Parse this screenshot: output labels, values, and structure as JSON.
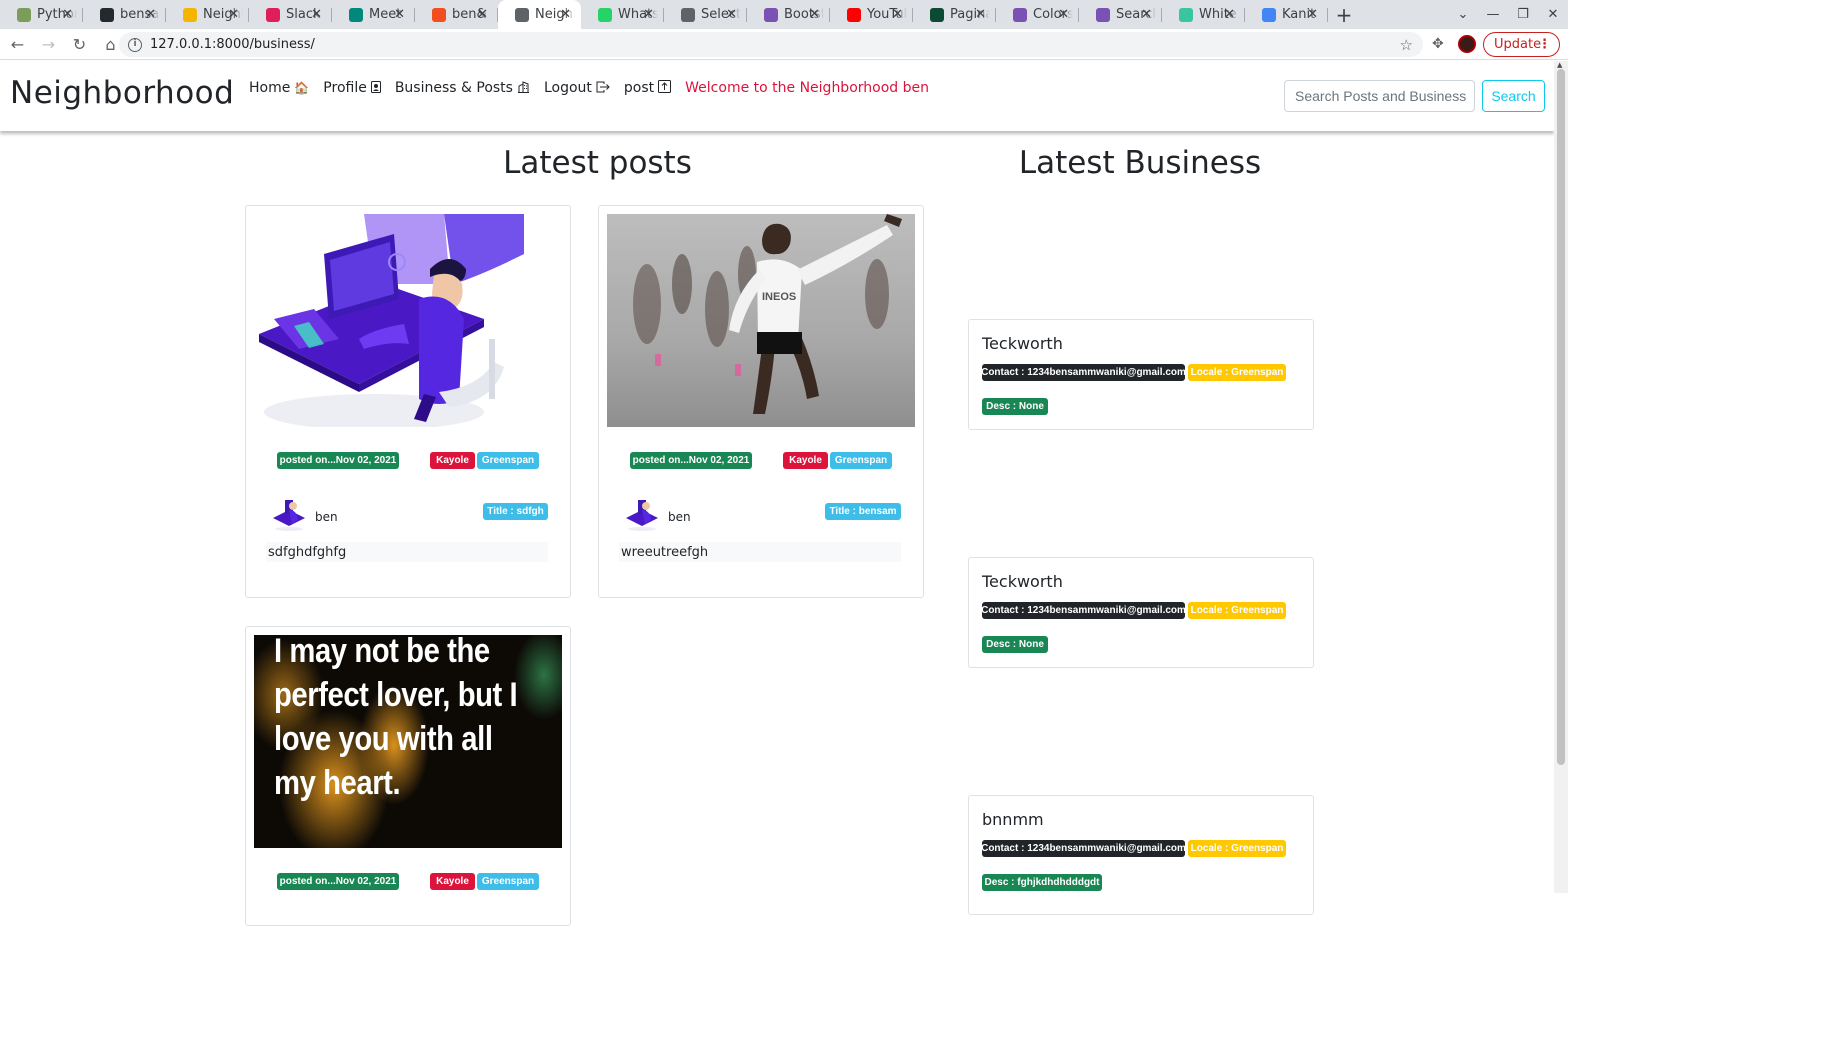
{
  "browser": {
    "tabs": [
      {
        "label": "Python",
        "icon": "python-favicon",
        "color": "#7c9c5c"
      },
      {
        "label": "bensam",
        "icon": "github-favicon",
        "color": "#24292e"
      },
      {
        "label": "Neighborhood",
        "icon": "drive-favicon",
        "color": "#f4b400"
      },
      {
        "label": "Slack",
        "icon": "slack-favicon",
        "color": "#e01e5a"
      },
      {
        "label": "Meet",
        "icon": "meet-favicon",
        "color": "#00897b"
      },
      {
        "label": "ben&",
        "icon": "figma-favicon",
        "color": "#f24e1e"
      },
      {
        "label": "Neighborhood",
        "icon": "globe-favicon",
        "color": "#5f6368"
      },
      {
        "label": "WhatsApp",
        "icon": "whatsapp-favicon",
        "color": "#25d366"
      },
      {
        "label": "Select",
        "icon": "globe-favicon",
        "color": "#5f6368"
      },
      {
        "label": "Bootstrap",
        "icon": "bootstrap-favicon",
        "color": "#7952b3"
      },
      {
        "label": "YouTube",
        "icon": "youtube-favicon",
        "color": "#ff0000"
      },
      {
        "label": "Pagination",
        "icon": "django-favicon",
        "color": "#0c4b33"
      },
      {
        "label": "Colors",
        "icon": "bootstrap-favicon",
        "color": "#7952b3"
      },
      {
        "label": "Search",
        "icon": "bootstrap-favicon",
        "color": "#7952b3"
      },
      {
        "label": "White",
        "icon": "d-favicon",
        "color": "#38c6a0"
      },
      {
        "label": "Kanit",
        "icon": "google-fonts-favicon",
        "color": "#4285f4"
      }
    ],
    "active_tab": 6,
    "url": "127.0.0.1:8000/business/",
    "update_label": "Update"
  },
  "nav": {
    "brand": "Neighborhood",
    "links": [
      {
        "label": "Home",
        "icon": "house-icon",
        "glyph": "🏠"
      },
      {
        "label": "Profile",
        "icon": "person-badge-icon",
        "glyph": "🪪"
      },
      {
        "label": "Business & Posts",
        "icon": "building-icon",
        "glyph": "🏢"
      },
      {
        "label": "Logout",
        "icon": "box-arrow-right-icon",
        "glyph": "⇨"
      },
      {
        "label": "post",
        "icon": "box-arrow-up-icon",
        "glyph": "⇧"
      }
    ],
    "welcome": "Welcome to the Neighborhood ben",
    "search_placeholder": "Search Posts and Business",
    "search_button": "Search"
  },
  "posts_heading": "Latest posts",
  "business_heading": "Latest Business",
  "posts": [
    {
      "image": "isometric-desk-illustration",
      "date": "posted on...Nov 02, 2021",
      "locale_name": "Kayole",
      "locale_area": "Greenspan",
      "author": "ben",
      "title": "Title : sdfgh",
      "body": "sdfghdfghfg"
    },
    {
      "image": "runner-photo",
      "date": "posted on...Nov 02, 2021",
      "locale_name": "Kayole",
      "locale_area": "Greenspan",
      "author": "ben",
      "title": "Title : bensam",
      "body": "wreeutreefgh"
    },
    {
      "image": "quote-image",
      "quote": "I may not be the perfect lover, but I love you with all my heart.",
      "date": "posted on...Nov 02, 2021",
      "locale_name": "Kayole",
      "locale_area": "Greenspan"
    }
  ],
  "businesses": [
    {
      "name": "Teckworth",
      "contact": "Contact : 1234bensammwaniki@gmail.com",
      "locale": "Locale : Greenspan",
      "desc": "Desc : None"
    },
    {
      "name": "Teckworth",
      "contact": "Contact : 1234bensammwaniki@gmail.com",
      "locale": "Locale : Greenspan",
      "desc": "Desc : None"
    },
    {
      "name": "bnnmm",
      "contact": "Contact : 1234bensammwaniki@gmail.com",
      "locale": "Locale : Greenspan",
      "desc": "Desc : fghjkdhdhdddgdt"
    }
  ],
  "colors": {
    "accent_red": "#dc143c",
    "success": "#198754",
    "info": "#3dbde8",
    "dark": "#212529",
    "warning": "#ffc800"
  }
}
